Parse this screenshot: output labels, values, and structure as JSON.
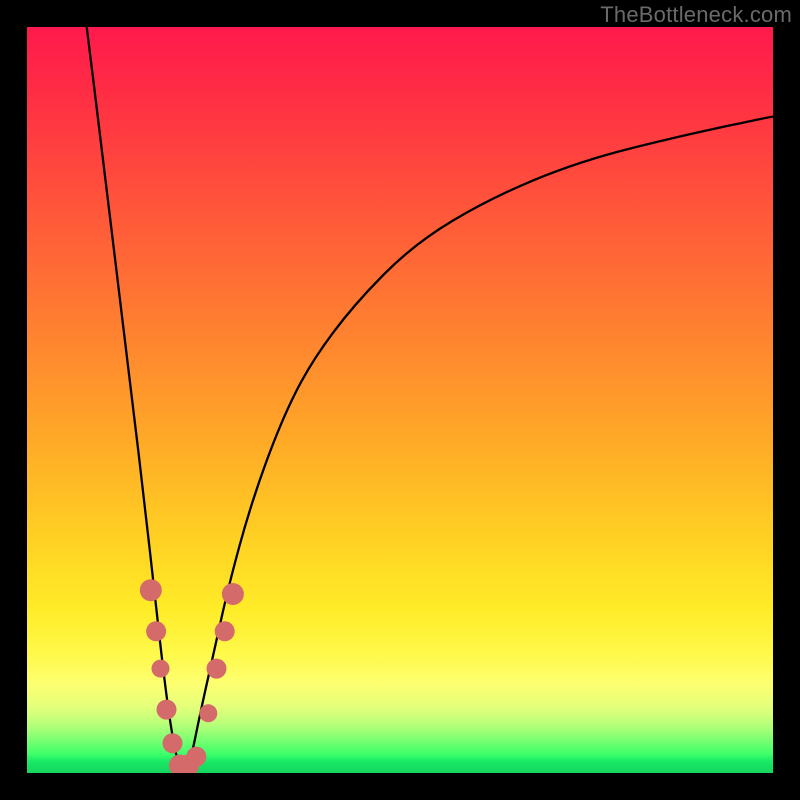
{
  "watermark": "TheBottleneck.com",
  "chart_data": {
    "type": "line",
    "title": "",
    "xlabel": "",
    "ylabel": "",
    "xlim": [
      0,
      100
    ],
    "ylim": [
      0,
      100
    ],
    "series": [
      {
        "name": "bottleneck-curve",
        "x": [
          8,
          10,
          12,
          14,
          16,
          17,
          18,
          19,
          20,
          21,
          22,
          23,
          25,
          27,
          30,
          34,
          38,
          44,
          52,
          62,
          74,
          88,
          100
        ],
        "y": [
          100,
          84,
          67,
          51,
          34,
          25,
          16,
          8,
          2,
          0,
          2,
          7,
          16,
          25,
          36,
          47,
          55,
          63,
          71,
          77,
          82,
          85.5,
          88
        ]
      }
    ],
    "markers": {
      "name": "highlight-cluster",
      "color": "#d46a6a",
      "points": [
        {
          "x": 16.6,
          "y": 24.5,
          "r": 11
        },
        {
          "x": 17.3,
          "y": 19,
          "r": 10
        },
        {
          "x": 17.9,
          "y": 14,
          "r": 9
        },
        {
          "x": 18.7,
          "y": 8.5,
          "r": 10
        },
        {
          "x": 19.5,
          "y": 4,
          "r": 10
        },
        {
          "x": 20.5,
          "y": 1,
          "r": 11
        },
        {
          "x": 21.6,
          "y": 1,
          "r": 11
        },
        {
          "x": 22.7,
          "y": 2.2,
          "r": 10
        },
        {
          "x": 24.3,
          "y": 8,
          "r": 9
        },
        {
          "x": 25.4,
          "y": 14,
          "r": 10
        },
        {
          "x": 26.5,
          "y": 19,
          "r": 10
        },
        {
          "x": 27.6,
          "y": 24,
          "r": 11
        }
      ]
    },
    "gradient_stops": [
      {
        "pos": 0,
        "color": "#ff1a4d"
      },
      {
        "pos": 50,
        "color": "#ff8a2e"
      },
      {
        "pos": 82,
        "color": "#fff94a"
      },
      {
        "pos": 100,
        "color": "#14d65e"
      }
    ]
  }
}
